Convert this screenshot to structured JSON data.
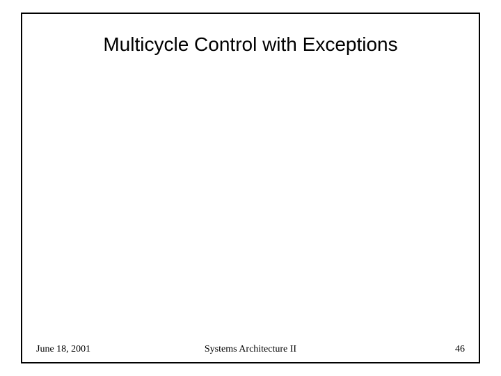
{
  "slide": {
    "title": "Multicycle Control with Exceptions"
  },
  "footer": {
    "date": "June 18, 2001",
    "course": "Systems Architecture II",
    "page": "46"
  }
}
